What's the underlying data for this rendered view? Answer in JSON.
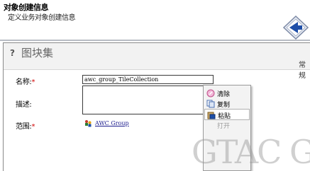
{
  "header": {
    "title": "对象创建信息",
    "subtitle": "定义业务对象创建信息",
    "logo_icon": "diamond-arrow-icon"
  },
  "panel": {
    "help_mark": "?",
    "title": "图块集",
    "tail_text": "常规"
  },
  "form": {
    "name_label": "名称:",
    "name_required": "*",
    "name_value": "awc_group_TileCollection",
    "description_label": "描述:",
    "description_value": "",
    "scope_label": "范围:",
    "scope_required": "*",
    "scope_value": "AWC Group",
    "scope_icon": "group-icon",
    "scope_dropdown_icon": "chevron-down-icon"
  },
  "context_menu": {
    "items": [
      {
        "label": "清除",
        "icon": "clear-icon"
      },
      {
        "label": "复制",
        "icon": "copy-icon"
      },
      {
        "label": "粘贴",
        "icon": "paste-icon"
      },
      {
        "label": "打开",
        "icon": "open-icon",
        "disabled": true
      }
    ]
  },
  "watermark": "GTAC Gr",
  "colors": {
    "required": "#d00000",
    "link": "#1a1a8c",
    "logo_blue": "#1f4fa8"
  }
}
